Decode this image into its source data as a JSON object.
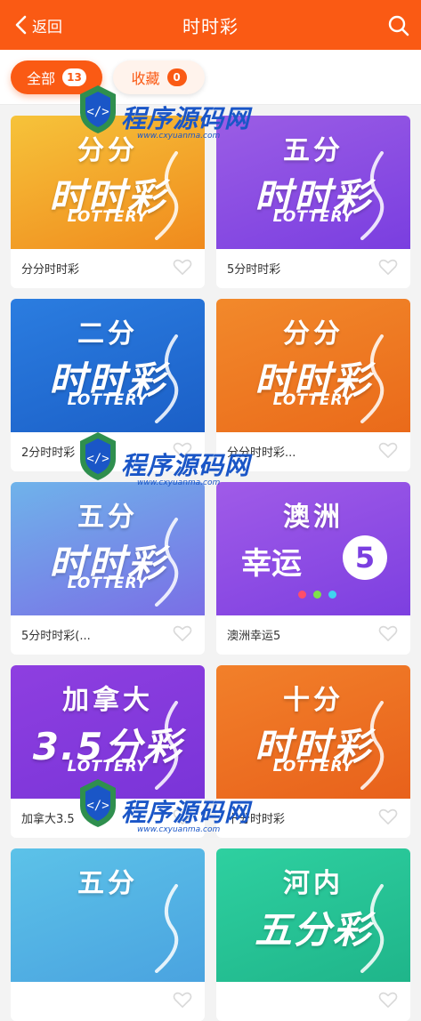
{
  "header": {
    "back_label": "返回",
    "title": "时时彩"
  },
  "tabs": [
    {
      "label": "全部",
      "count": "13"
    },
    {
      "label": "收藏",
      "count": "0"
    }
  ],
  "cards": [
    {
      "name": "分分时时彩",
      "top": "分分",
      "main": "时时彩",
      "sub": "LOTTERY",
      "gradient": [
        "#f6c33a",
        "#f08a1d"
      ]
    },
    {
      "name": "5分时时彩",
      "top": "五分",
      "main": "时时彩",
      "sub": "LOTTERY",
      "gradient": [
        "#9b5de5",
        "#7a3ee0"
      ]
    },
    {
      "name": "2分时时彩",
      "top": "二分",
      "main": "时时彩",
      "sub": "LOTTERY",
      "gradient": [
        "#2b7de0",
        "#1b5fc7"
      ]
    },
    {
      "name": "分分时时彩...",
      "top": "分分",
      "main": "时时彩",
      "sub": "LOTTERY",
      "gradient": [
        "#f2892b",
        "#ea6a1a"
      ]
    },
    {
      "name": "5分时时彩(...",
      "top": "五分",
      "main": "时时彩",
      "sub": "LOTTERY",
      "gradient": [
        "#6fb3ea",
        "#7a6ee6"
      ]
    },
    {
      "name": "澳洲幸运5",
      "top": "澳洲",
      "main": "幸运",
      "sub": "5",
      "gradient": [
        "#a05be8",
        "#7d3fe0"
      ]
    },
    {
      "name": "加拿大3.5",
      "top": "加拿大",
      "main": "3.5分彩",
      "sub": "LOTTERY",
      "gradient": [
        "#8e3fe0",
        "#7a34d8"
      ]
    },
    {
      "name": "十分时时彩",
      "top": "十分",
      "main": "时时彩",
      "sub": "LOTTERY",
      "gradient": [
        "#f2802a",
        "#e8611b"
      ]
    },
    {
      "name": "",
      "top": "五分",
      "main": "",
      "sub": "",
      "gradient": [
        "#5cc2e8",
        "#4aa3e0"
      ]
    },
    {
      "name": "",
      "top": "河内",
      "main": "五分彩",
      "sub": "",
      "gradient": [
        "#2ed0a0",
        "#1fb58a"
      ]
    }
  ],
  "watermark": {
    "text": "程序源码网",
    "url": "www.cxyuanma.com"
  },
  "colors": {
    "accent": "#fa5a14",
    "heart_outline": "#d9d9d9"
  },
  "icons": {
    "back": "chevron-left-icon",
    "search": "search-icon",
    "favorite": "heart-icon"
  }
}
